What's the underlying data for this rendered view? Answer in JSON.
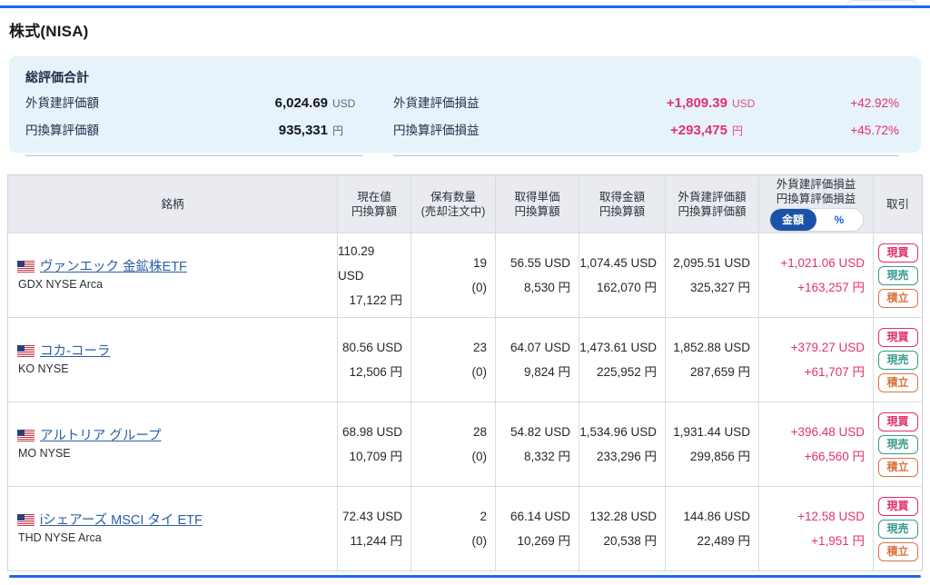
{
  "colors": {
    "accent_blue": "#1c6ce2",
    "profit_pink": "#e3316f",
    "link_blue": "#2b5ea7",
    "buy_red": "#df2e68",
    "sell_teal": "#38988e",
    "accumulate_orange": "#dc7442",
    "summary_bg": "#e7f3fa",
    "table_header_bg": "#e9ebf1"
  },
  "page_title": "株式(NISA)",
  "summary": {
    "title": "総評価合計",
    "left": [
      {
        "label": "外貨建評価額",
        "value": "6,024.69",
        "unit": "USD"
      },
      {
        "label": "円換算評価額",
        "value": "935,331",
        "unit": "円"
      }
    ],
    "right": [
      {
        "label": "外貨建評価損益",
        "value": "+1,809.39",
        "unit": "USD",
        "pct": "+42.92%"
      },
      {
        "label": "円換算評価損益",
        "value": "+293,475",
        "unit": "円",
        "pct": "+45.72%"
      }
    ]
  },
  "table": {
    "headers": {
      "name": "銘柄",
      "price": [
        "現在値",
        "円換算額"
      ],
      "quantity": [
        "保有数量",
        "(売却注文中)"
      ],
      "unit_cost": [
        "取得単価",
        "円換算額"
      ],
      "acq_amount": [
        "取得金額",
        "円換算額"
      ],
      "valuation": [
        "外貨建評価額",
        "円換算評価額"
      ],
      "pl": [
        "外貨建評価損益",
        "円換算評価損益"
      ],
      "trade": "取引",
      "toggle": {
        "amount": "金額",
        "percent": "%"
      }
    },
    "actions": {
      "buy": "現買",
      "sell": "現売",
      "accumulate": "積立"
    },
    "rows": [
      {
        "name": "ヴァンエック 金鉱株ETF",
        "ticker": "GDX NYSE Arca",
        "price_usd": "110.29 USD",
        "price_jpy": "17,122 円",
        "qty": "19",
        "qty_sub": "(0)",
        "unit_cost_usd": "56.55 USD",
        "unit_cost_jpy": "8,530 円",
        "acq_usd": "1,074.45 USD",
        "acq_jpy": "162,070 円",
        "val_usd": "2,095.51 USD",
        "val_jpy": "325,327 円",
        "pl_usd": "+1,021.06 USD",
        "pl_jpy": "+163,257 円"
      },
      {
        "name": "コカ-コーラ",
        "ticker": "KO NYSE",
        "price_usd": "80.56 USD",
        "price_jpy": "12,506 円",
        "qty": "23",
        "qty_sub": "(0)",
        "unit_cost_usd": "64.07 USD",
        "unit_cost_jpy": "9,824 円",
        "acq_usd": "1,473.61 USD",
        "acq_jpy": "225,952 円",
        "val_usd": "1,852.88 USD",
        "val_jpy": "287,659 円",
        "pl_usd": "+379.27 USD",
        "pl_jpy": "+61,707 円"
      },
      {
        "name": "アルトリア グループ",
        "ticker": "MO NYSE",
        "price_usd": "68.98 USD",
        "price_jpy": "10,709 円",
        "qty": "28",
        "qty_sub": "(0)",
        "unit_cost_usd": "54.82 USD",
        "unit_cost_jpy": "8,332 円",
        "acq_usd": "1,534.96 USD",
        "acq_jpy": "233,296 円",
        "val_usd": "1,931.44 USD",
        "val_jpy": "299,856 円",
        "pl_usd": "+396.48 USD",
        "pl_jpy": "+66,560 円"
      },
      {
        "name": "iシェアーズ MSCI タイ ETF",
        "ticker": "THD NYSE Arca",
        "price_usd": "72.43 USD",
        "price_jpy": "11,244 円",
        "qty": "2",
        "qty_sub": "(0)",
        "unit_cost_usd": "66.14 USD",
        "unit_cost_jpy": "10,269 円",
        "acq_usd": "132.28 USD",
        "acq_jpy": "20,538 円",
        "val_usd": "144.86 USD",
        "val_jpy": "22,489 円",
        "pl_usd": "+12.58 USD",
        "pl_jpy": "+1,951 円"
      }
    ]
  }
}
